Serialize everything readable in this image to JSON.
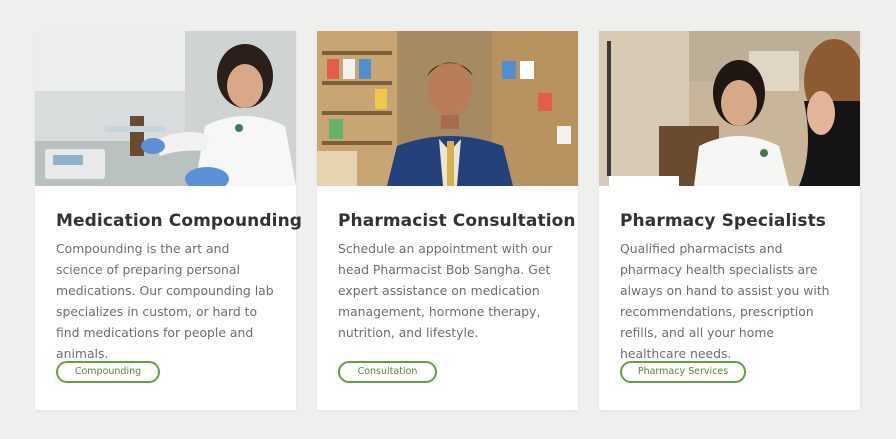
{
  "cards": [
    {
      "image_name": "pharmacist-compounding-photo",
      "title": "Medication Compounding",
      "description": "Compounding is the art and science of preparing personal medications. Our compounding lab specializes in custom, or hard to find medications for people and animals.",
      "button_label": "Compounding"
    },
    {
      "image_name": "pharmacist-portrait-photo",
      "title": "Pharmacist Consultation",
      "description": "Schedule an appointment with our head Pharmacist Bob Sangha. Get expert assistance on medication management, hormone therapy, nutrition, and lifestyle.",
      "button_label": "Consultation"
    },
    {
      "image_name": "pharmacy-specialist-photo",
      "title": "Pharmacy Specialists",
      "description": "Qualified pharmacists and pharmacy health specialists are always on hand to assist you with recommendations, prescription refills, and all your home healthcare needs.",
      "button_label": "Pharmacy Services"
    }
  ],
  "colors": {
    "background": "#efefee",
    "card": "#ffffff",
    "accent_green": "#5fa33d",
    "title_text": "#2f3336",
    "body_text": "#6a6e71"
  }
}
